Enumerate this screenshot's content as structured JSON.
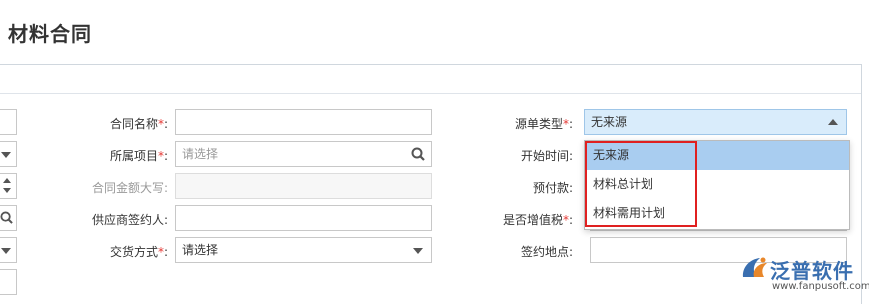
{
  "page_title": "材料合同",
  "form": {
    "contract_name": {
      "label": "合同名称",
      "required": "*",
      "colon": ":",
      "value": ""
    },
    "project": {
      "label": "所属项目",
      "required": "*",
      "colon": ":",
      "placeholder": "请选择"
    },
    "amount_upper": {
      "label": "合同金额大写",
      "colon": ":",
      "value": ""
    },
    "supplier_signer": {
      "label": "供应商签约人",
      "colon": ":",
      "value": ""
    },
    "delivery": {
      "label": "交货方式",
      "required": "*",
      "colon": ":",
      "placeholder": "请选择"
    },
    "source_type": {
      "label": "源单类型",
      "required": "*",
      "colon": ":",
      "value": "无来源"
    },
    "start_time": {
      "label": "开始时间",
      "colon": ":"
    },
    "prepayment": {
      "label": "预付款",
      "colon": ":"
    },
    "vat": {
      "label": "是否增值税",
      "required": "*",
      "colon": ":"
    },
    "sign_place": {
      "label": "签约地点",
      "colon": ":",
      "value": ""
    }
  },
  "dropdown": {
    "options": [
      "无来源",
      "材料总计划",
      "材料需用计划"
    ],
    "active_index": 0
  },
  "logo": {
    "name": "泛普软件",
    "url": "www.fanpusoft.com"
  },
  "colors": {
    "accent_blue": "#a9cdf0",
    "highlight_red": "#e02020"
  }
}
